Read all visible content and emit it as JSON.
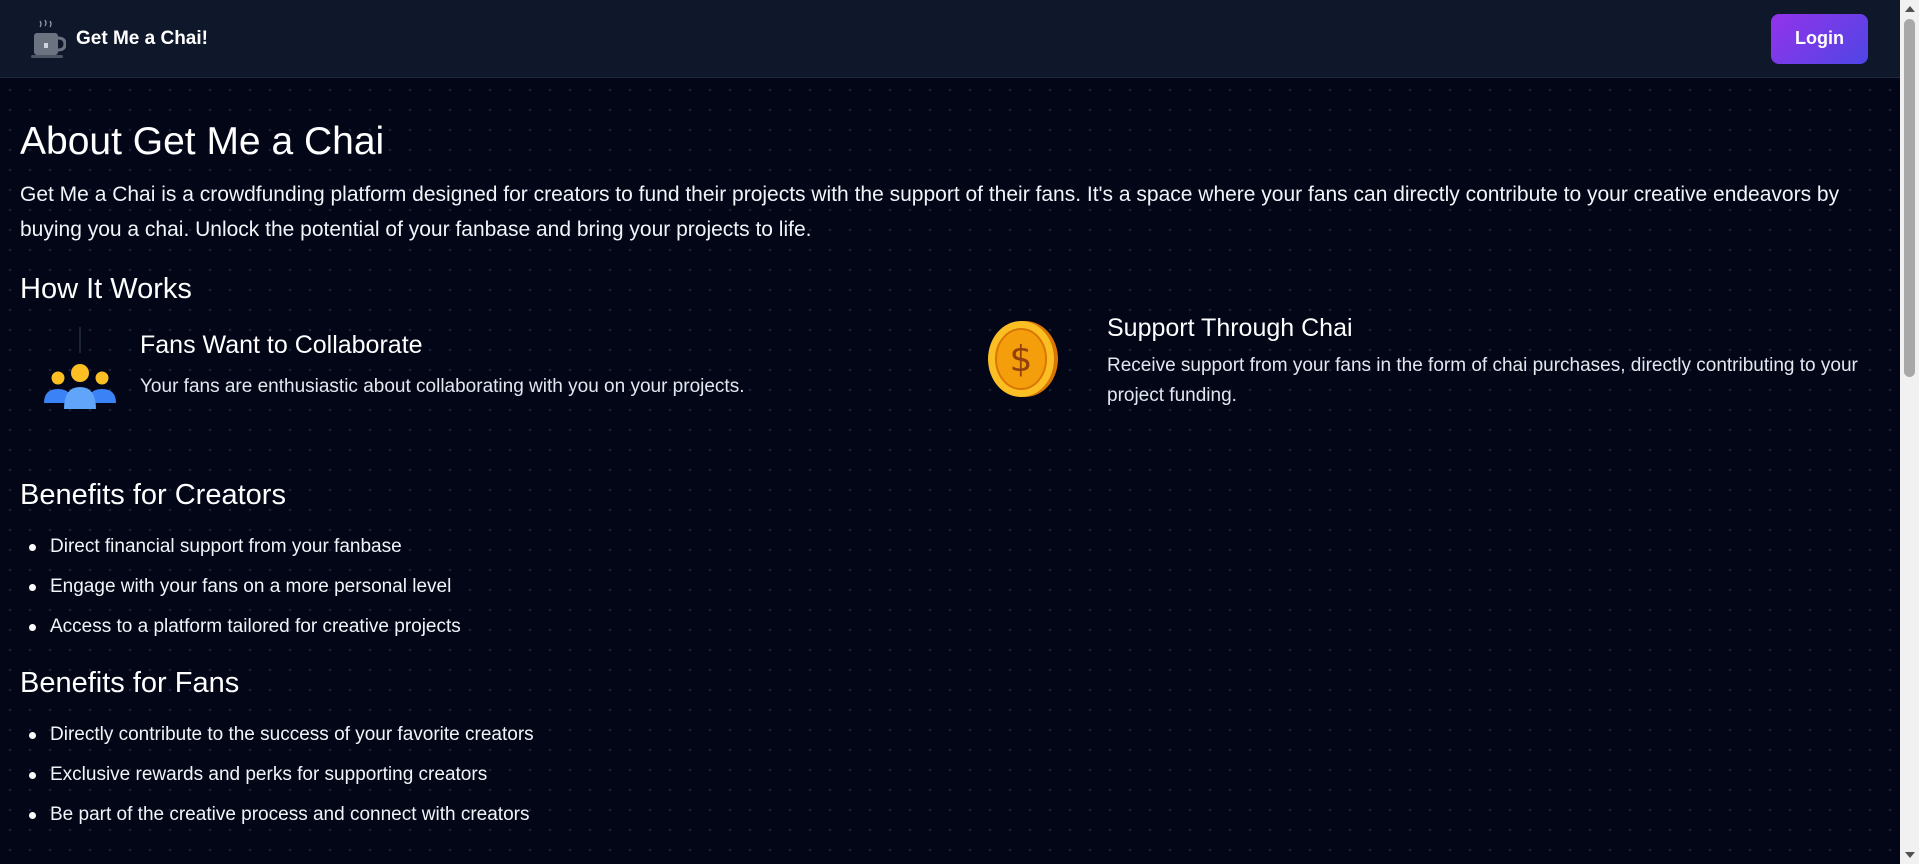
{
  "nav": {
    "brand": "Get Me a Chai!",
    "login_label": "Login",
    "logo_icon": "tea-cup-icon"
  },
  "about": {
    "title": "About Get Me a Chai",
    "intro": "Get Me a Chai is a crowdfunding platform designed for creators to fund their projects with the support of their fans. It's a space where your fans can directly contribute to your creative endeavors by buying you a chai. Unlock the potential of your fanbase and bring your projects to life."
  },
  "how": {
    "title": "How It Works",
    "items": [
      {
        "icon": "group-icon",
        "title": "Fans Want to Collaborate",
        "text": "Your fans are enthusiastic about collaborating with you on your projects."
      },
      {
        "icon": "coin-icon",
        "title": "Support Through Chai",
        "text": "Receive support from your fans in the form of chai purchases, directly contributing to your project funding."
      }
    ]
  },
  "creators": {
    "title": "Benefits for Creators",
    "items": [
      "Direct financial support from your fanbase",
      "Engage with your fans on a more personal level",
      "Access to a platform tailored for creative projects"
    ]
  },
  "fans": {
    "title": "Benefits for Fans",
    "items": [
      "Directly contribute to the success of your favorite creators",
      "Exclusive rewards and perks for supporting creators",
      "Be part of the creative process and connect with creators"
    ]
  },
  "colors": {
    "background": "#020617",
    "navbar": "#0f172a",
    "login_gradient_start": "#9333ea",
    "login_gradient_end": "#4f46e5",
    "coin": "#fbbf24",
    "group_people": "#3b82f6"
  }
}
